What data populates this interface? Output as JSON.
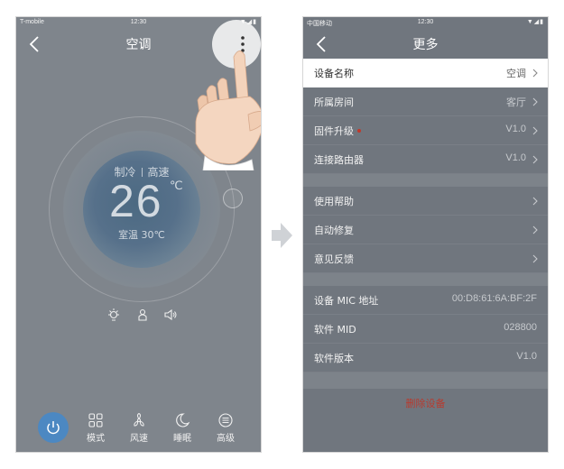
{
  "left_phone": {
    "status": {
      "carrier": "T-mobile",
      "time": "12:30"
    },
    "title": "空调",
    "mode": "制冷",
    "speed": "高速",
    "temperature": "26",
    "temp_unit": "℃",
    "room_temp": "室温 30℃",
    "tabs": [
      {
        "label": "模式",
        "icon": "grid-icon"
      },
      {
        "label": "风速",
        "icon": "fan-icon"
      },
      {
        "label": "睡眠",
        "icon": "moon-icon"
      },
      {
        "label": "高级",
        "icon": "menu-circle-icon"
      }
    ],
    "colors": {
      "overlay": "#7f858c",
      "power": "#4c88c2"
    }
  },
  "right_phone": {
    "status": {
      "carrier": "中国移动",
      "time": "12:30"
    },
    "title": "更多",
    "group1": [
      {
        "label": "设备名称",
        "value": "空调",
        "highlight": true
      },
      {
        "label": "所属房间",
        "value": "客厅"
      },
      {
        "label": "固件升级",
        "value": "V1.0",
        "badge": true
      },
      {
        "label": "连接路由器",
        "value": "V1.0"
      }
    ],
    "group2": [
      {
        "label": "使用帮助"
      },
      {
        "label": "自动修复"
      },
      {
        "label": "意见反馈"
      }
    ],
    "group3": [
      {
        "label": "设备 MIC 地址",
        "value": "00:D8:61:6A:BF:2F"
      },
      {
        "label": "软件 MID",
        "value": "028800"
      },
      {
        "label": "软件版本",
        "value": "V1.0"
      }
    ],
    "delete_label": "删除设备",
    "colors": {
      "overlay": "#70767e",
      "danger": "#b83a2e",
      "badge": "#c0392b"
    }
  }
}
